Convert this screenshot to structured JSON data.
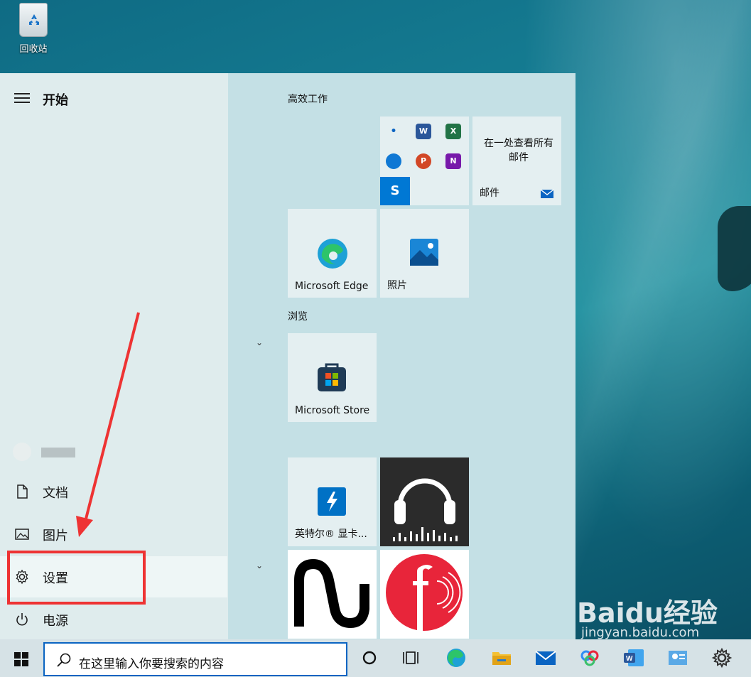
{
  "desktop": {
    "recycle_bin_label": "回收站"
  },
  "start_menu": {
    "title": "开始",
    "left_items": [
      {
        "label": "文档",
        "icon": "document-icon"
      },
      {
        "label": "图片",
        "icon": "pictures-icon"
      },
      {
        "label": "设置",
        "icon": "gear-icon"
      },
      {
        "label": "电源",
        "icon": "power-icon"
      }
    ],
    "groups": [
      {
        "title": "高效工作"
      },
      {
        "title": "浏览"
      }
    ],
    "tiles": {
      "mail_text": "在一处查看所有邮件",
      "mail_label": "邮件",
      "edge_label": "Microsoft Edge",
      "photos_label": "照片",
      "store_label": "Microsoft Store",
      "intel_label": "英特尔® 显卡...",
      "office_apps": [
        "Outlook",
        "Word",
        "Excel",
        "OneDrive",
        "PowerPoint",
        "OneNote",
        "Skype"
      ]
    }
  },
  "taskbar": {
    "search_placeholder": "在这里输入你要搜索的内容",
    "icons": [
      "cortana-icon",
      "task-view-icon",
      "edge-icon",
      "file-explorer-icon",
      "mail-icon",
      "baidu-netdisk-icon",
      "word-icon",
      "contact-card-icon",
      "gear-icon"
    ]
  },
  "watermark": {
    "brand": "Baidu经验",
    "url": "jingyan.baidu.com"
  },
  "colors": {
    "annotation_red": "#ee3333",
    "search_border": "#0a64c2"
  }
}
